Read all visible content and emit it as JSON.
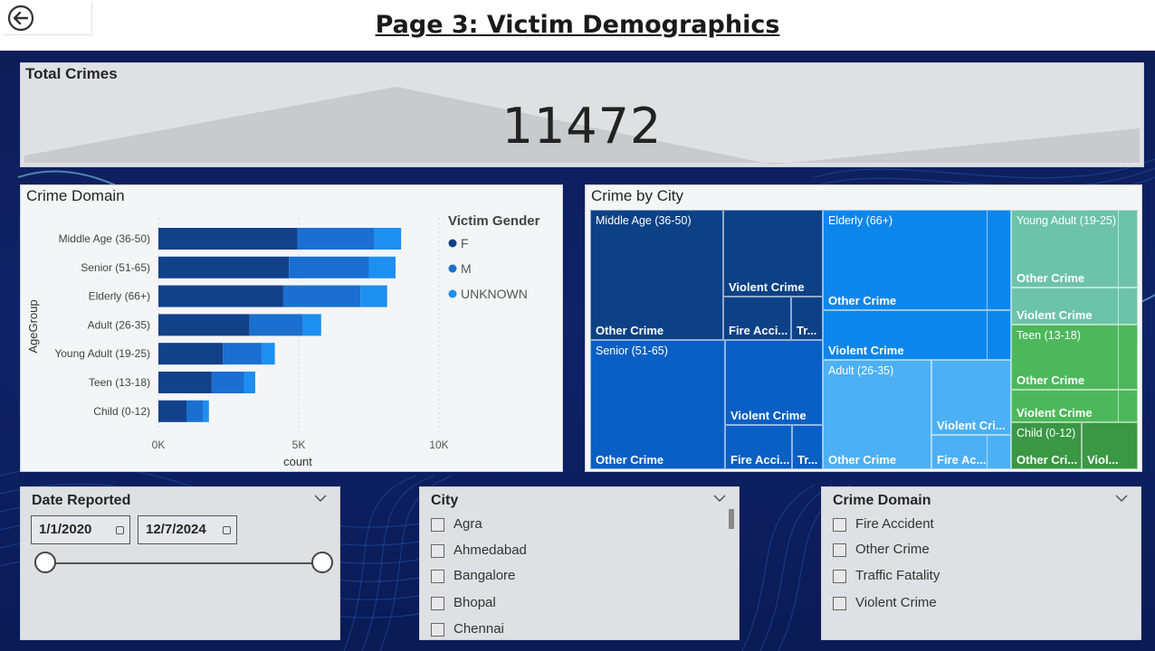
{
  "page": {
    "title": "Page 3: Victim Demographics"
  },
  "back_button": {
    "icon": "back-arrow-icon"
  },
  "kpi": {
    "label": "Total Crimes",
    "value": "11472"
  },
  "bar_chart": {
    "title": "Crime Domain"
  },
  "treemap": {
    "title": "Crime by City",
    "cells": [
      {
        "group": "Middle Age (36-50)",
        "label": "Other Crime"
      },
      {
        "label": "Violent Crime"
      },
      {
        "label": "Fire Acci..."
      },
      {
        "label": "Tr..."
      },
      {
        "group": "Senior (51-65)",
        "label": "Other Crime"
      },
      {
        "label": "Violent Crime"
      },
      {
        "label": "Fire Acci..."
      },
      {
        "label": "Tr..."
      },
      {
        "group": "Elderly (66+)",
        "label": "Other Crime"
      },
      {
        "label": "Violent Crime"
      },
      {
        "group": "Adult (26-35)",
        "label": "Other Crime"
      },
      {
        "label": "Violent Cri..."
      },
      {
        "label": "Fire Ac..."
      },
      {
        "group": "Young Adult (19-25)",
        "label": "Other Crime"
      },
      {
        "label": "Violent Crime"
      },
      {
        "group": "Teen (13-18)",
        "label": "Other Crime"
      },
      {
        "label": "Violent Crime"
      },
      {
        "group": "Child (0-12)",
        "label": "Other Cri..."
      },
      {
        "label": "Viol..."
      }
    ]
  },
  "date_slicer": {
    "title": "Date Reported",
    "start": "1/1/2020",
    "end": "12/7/2024"
  },
  "city_slicer": {
    "title": "City",
    "options": [
      "Agra",
      "Ahmedabad",
      "Bangalore",
      "Bhopal",
      "Chennai"
    ]
  },
  "domain_slicer": {
    "title": "Crime Domain",
    "options": [
      "Fire Accident",
      "Other Crime",
      "Traffic Fatality",
      "Violent Crime"
    ]
  },
  "colors": {
    "F": "#12418a",
    "M": "#1a6fd0",
    "UNKNOWN": "#1d8ff0"
  },
  "chart_data": {
    "type": "bar",
    "orientation": "horizontal",
    "stacked": true,
    "categories": [
      "Middle Age (36-50)",
      "Senior (51-65)",
      "Elderly (66+)",
      "Adult (26-35)",
      "Young Adult (19-25)",
      "Teen (13-18)",
      "Child (0-12)"
    ],
    "series": [
      {
        "name": "F",
        "values": [
          4950,
          4650,
          4450,
          3250,
          2300,
          1900,
          1000
        ]
      },
      {
        "name": "M",
        "values": [
          2750,
          2850,
          2750,
          1900,
          1400,
          1150,
          600
        ]
      },
      {
        "name": "UNKNOWN",
        "values": [
          950,
          950,
          950,
          650,
          450,
          400,
          200
        ]
      }
    ],
    "xlabel": "count",
    "ylabel": "AgeGroup",
    "xticks": [
      "0K",
      "5K",
      "10K"
    ],
    "xlim": [
      0,
      10000
    ],
    "legend_title": "Victim Gender",
    "legend_position": "right",
    "grid": true
  }
}
